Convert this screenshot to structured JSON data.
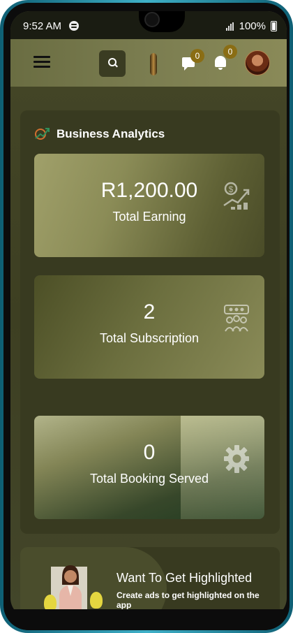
{
  "status_bar": {
    "time": "9:52 AM",
    "battery": "100%"
  },
  "header": {
    "chat_badge": "0",
    "notification_badge": "0"
  },
  "analytics": {
    "title": "Business Analytics",
    "cards": [
      {
        "value": "R1,200.00",
        "label": "Total Earning",
        "icon": "earnings-chart-icon"
      },
      {
        "value": "2",
        "label": "Total Subscription",
        "icon": "audience-icon"
      },
      {
        "value": "0",
        "label": "Total Booking Served",
        "icon": "gear-icon"
      }
    ]
  },
  "promo": {
    "title": "Want To Get Highlighted",
    "text": "Create ads to get highlighted on the app"
  },
  "colors": {
    "accent": "#8a6d14",
    "card_panel": "#383a20",
    "topbar": "#7b7d50"
  }
}
